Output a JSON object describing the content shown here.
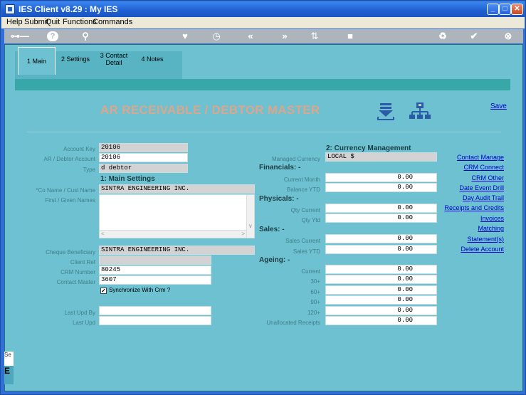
{
  "window": {
    "title": "IES Client v8.29 : My IES"
  },
  "menu": [
    "Help",
    "Submit",
    "Quit",
    "Functions",
    "Commands"
  ],
  "toolbar_icons": [
    "key-icon",
    "help-icon",
    "search-icon",
    "heart-icon",
    "clock-icon",
    "rewind-icon",
    "fast-forward-icon",
    "sort-icon",
    "stop-icon",
    "recycle-icon",
    "check-icon",
    "close-icon"
  ],
  "tabs": [
    {
      "label": "1 Main"
    },
    {
      "label": "2 Settings"
    },
    {
      "label": "3 Contact Detail"
    },
    {
      "label": "4 Notes"
    }
  ],
  "page_title": "AR RECEIVABLE / DEBTOR MASTER",
  "save_label": "Save",
  "fields": {
    "account_key": {
      "label": "Account Key",
      "value": "20106"
    },
    "ar_debtor_account": {
      "label": "AR / Debtor Account",
      "value": "20106"
    },
    "type": {
      "label": "Type",
      "value": "d debtor"
    },
    "co_name": {
      "label": "*Co Name / Cust Name",
      "value": "SINTRA ENGINEERING INC."
    },
    "first_names": {
      "label": "First / Given Names",
      "value": ""
    },
    "cheque_beneficiary": {
      "label": "Cheque Beneficiary",
      "value": "SINTRA ENGINEERING INC."
    },
    "client_ref": {
      "label": "Client Ref",
      "value": ""
    },
    "crm_number": {
      "label": "CRM Number",
      "value": "80245"
    },
    "contact_master": {
      "label": "Contact Master",
      "value": "3607"
    },
    "sync_crm": {
      "label": "Synchronize With Crm ?",
      "checked": true
    },
    "last_upd_by": {
      "label": "Last Upd By",
      "value": ""
    },
    "last_upd": {
      "label": "Last Upd",
      "value": ""
    }
  },
  "sections": {
    "main_settings": "1: Main Settings",
    "currency": "2: Currency Management",
    "financials": "Financials: -",
    "physicals": "Physicals: -",
    "sales": "Sales: -",
    "ageing": "Ageing: -"
  },
  "right_fields": {
    "managed_currency": {
      "label": "Managed Currency",
      "value": "LOCAL $"
    },
    "current_month": {
      "label": "Current Month",
      "value": "0.00"
    },
    "balance_ytd": {
      "label": "Balance YTD",
      "value": "0.00"
    },
    "qty_current": {
      "label": "Qty Current",
      "value": "0.00"
    },
    "qty_ytd": {
      "label": "Qty Ytd",
      "value": "0.00"
    },
    "sales_current": {
      "label": "Sales Current",
      "value": "0.00"
    },
    "sales_ytd": {
      "label": "Sales YTD",
      "value": "0.00"
    },
    "ageing_current": {
      "label": "Current",
      "value": "0.00"
    },
    "ageing_30": {
      "label": "30+",
      "value": "0.00"
    },
    "ageing_60": {
      "label": "60+",
      "value": "0.00"
    },
    "ageing_90": {
      "label": "90+",
      "value": "0.00"
    },
    "ageing_120": {
      "label": "120+",
      "value": "0.00"
    },
    "unallocated": {
      "label": "Unallocated Receipts",
      "value": "0.00"
    }
  },
  "links": [
    "Contact Manage",
    "CRM Connect",
    "CRM Other",
    "Date Event Drill",
    "Day Audit Trail",
    "Receipts and Credits",
    "Invoices",
    "Matching",
    "Statement(s)",
    "Delete Account"
  ],
  "sidebits": {
    "top": "Se",
    "bottom": "E"
  },
  "colors": {
    "background": "#6ec1d0",
    "title": "#dba68b",
    "link": "#0000cc",
    "tab_band": "#38a7a7"
  }
}
